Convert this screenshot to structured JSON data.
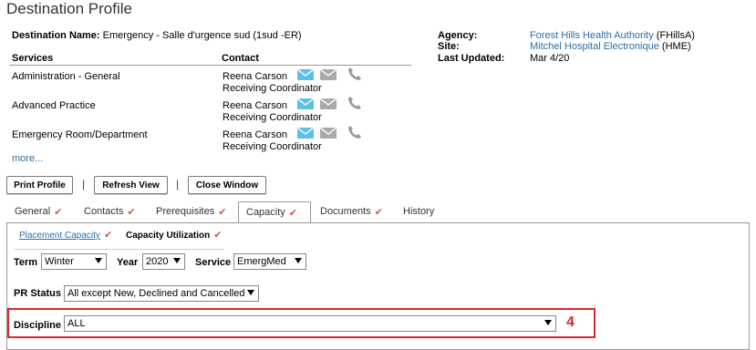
{
  "title": "Destination Profile",
  "destination": {
    "label": "Destination Name:",
    "value": "Emergency - Salle d'urgence sud (1sud -ER)"
  },
  "services_header": "Services",
  "contact_header": "Contact",
  "services": [
    {
      "name": "Administration - General",
      "contact": "Reena Carson",
      "role": "Receiving Coordinator"
    },
    {
      "name": "Advanced Practice",
      "contact": "Reena Carson",
      "role": "Receiving Coordinator"
    },
    {
      "name": "Emergency Room/Department",
      "contact": "Reena Carson",
      "role": "Receiving Coordinator"
    }
  ],
  "more_link": "more...",
  "info": {
    "agency_label": "Agency:",
    "agency_value": "Forest Hills Health Authority",
    "agency_code": "(FHillsA)",
    "site_label": "Site:",
    "site_value": "Mitchel Hospital Electronique",
    "site_code": "(HME)",
    "updated_label": "Last Updated:",
    "updated_value": "Mar 4/20"
  },
  "buttons": {
    "print": "Print Profile",
    "refresh": "Refresh View",
    "close": "Close Window"
  },
  "separator": "|",
  "tabs": [
    {
      "label": "General",
      "check": "✔"
    },
    {
      "label": "Contacts",
      "check": "✔"
    },
    {
      "label": "Prerequisites",
      "check": "✔"
    },
    {
      "label": "Capacity",
      "check": "✔"
    },
    {
      "label": "Documents",
      "check": "✔"
    },
    {
      "label": "History",
      "check": ""
    }
  ],
  "subtabs": {
    "placement": "Placement Capacity",
    "utilization": "Capacity Utilization",
    "check": "✔"
  },
  "filters": {
    "term_label": "Term",
    "term_value": "Winter",
    "year_label": "Year",
    "year_value": "2020",
    "service_label": "Service",
    "service_value": "EmergMed",
    "pr_label": "PR Status",
    "pr_value": "All except New, Declined and Cancelled",
    "discipline_label": "Discipline",
    "discipline_value": "ALL"
  },
  "annotation": "4",
  "colors": {
    "link": "#2a6fa8",
    "check": "#d9534f",
    "highlight": "#e0262b",
    "mail_active": "#5bc0e8",
    "icon_gray": "#999999"
  }
}
